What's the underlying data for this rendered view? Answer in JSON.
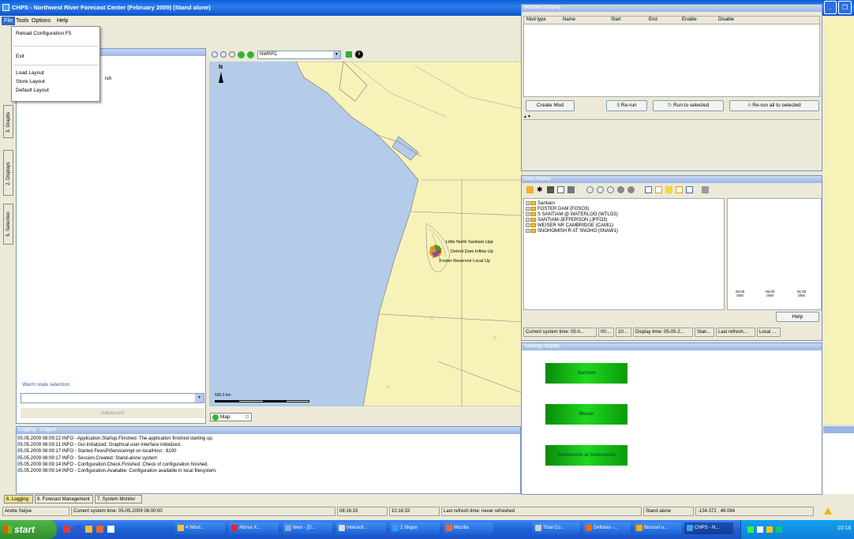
{
  "window": {
    "title": "CHPS - Northwest River Forecast Center (February 2009)  (Stand alone)"
  },
  "menubar": [
    "File",
    "Tools",
    "Options",
    "Help"
  ],
  "file_menu": [
    "Reload Configuration  F5",
    "Exit",
    "Load Layout",
    "Store Layout",
    "Default Layout"
  ],
  "left_panel": {
    "hidden_text": "ish",
    "vtabs": [
      "3. Graphs",
      "2. Displays",
      "5. Selection"
    ],
    "warm_state_label": "Warm state selection",
    "advanced_label": "Advanced"
  },
  "map": {
    "region_select": "NWRFC",
    "north_label": "N",
    "scale_label": "500.0 km",
    "tab_label": "Map",
    "site_labels": [
      "Little North Santiam Upp",
      "Detroit Dam Inflow Up",
      "Foster Reservoir Local Up"
    ]
  },
  "modifiers": {
    "title": "Modifiers Display",
    "columns": [
      "Mod type",
      "Name",
      "Start",
      "End",
      "Enable",
      "Disable"
    ],
    "buttons": {
      "create": "Create Mod",
      "rerun": "Re-run",
      "run_to_selected": "Run to selected",
      "rerun_all": "Re-run all to selected"
    }
  },
  "data_display": {
    "title": "Data Display",
    "tree": [
      "Santiam",
      "FOSTER DAM (FOSO3)",
      "S SANTIAM @ WATERLOO (WTLO3)",
      "SANTIAM-JEFFERSON (JFFO3)",
      "WEISER NR CAMBRIDGE (CAMI1)",
      "SNOHOMISH R AT SNOHO (SNAW1)"
    ],
    "time_ticks": [
      "00:00\n0/00",
      "06:00\n0/00",
      "01:00\n0/00"
    ],
    "help_label": "Help",
    "status": [
      "Current system time: 05-0...",
      "00:...",
      "10:...",
      "Display time: 05-05-2...",
      "Stan...",
      "Last refresh...",
      "Local ..."
    ]
  },
  "topology": {
    "title": "Topology display",
    "nodes": [
      "Santiam",
      "Weiser",
      "Snohomish at Snohomish"
    ]
  },
  "logging": {
    "tabs": [
      "Logging",
      "Logged"
    ],
    "lines": [
      "05.05.2009 08:09:22 INFO - Application.Startup.Finished: The application finished starting up.",
      "05.05.2009 08:09:21 INFO - Gui.Initialized: Graphical user interface initialized.",
      "05.05.2009 08:09:17 INFO - Started FewsPiServiceImpl on localHost : 8100",
      "05.05.2009 08:09:17 INFO - Session.Created: Stand-alone system",
      "05.05.2009 08:09:14 INFO - Configuration.Check.Finished: Check of configuration finished.",
      "05.05.2009 08:09:14 INFO - Configuration.Available: Configuration available in local filesystem."
    ],
    "bottom_tabs": [
      "6. Logging",
      "8. Forecast Management",
      "7. System Monitor"
    ]
  },
  "statusbar": [
    "Andre Seijse",
    "Current system time: 05-05-2009 06:00:00",
    "08:16:33",
    "10:16:33",
    "Last refresh time: never refreshed",
    "Stand alone",
    "-134.372 , 49.084"
  ],
  "taskbar": {
    "start": "start",
    "tasks": [
      "4 Wind...",
      "Altova X...",
      "fews - [D...",
      "Interacti...",
      "2 Skype",
      "Mozilla",
      "Total Co...",
      "Deltares -...",
      "Brussel a...",
      "CHPS - N..."
    ],
    "clock": "10:16"
  },
  "colors": {
    "sea": "#b4cbe9",
    "land": "#f7f2b8",
    "xp_blue": "#0a53c6",
    "green_node": "#1fd81f"
  }
}
